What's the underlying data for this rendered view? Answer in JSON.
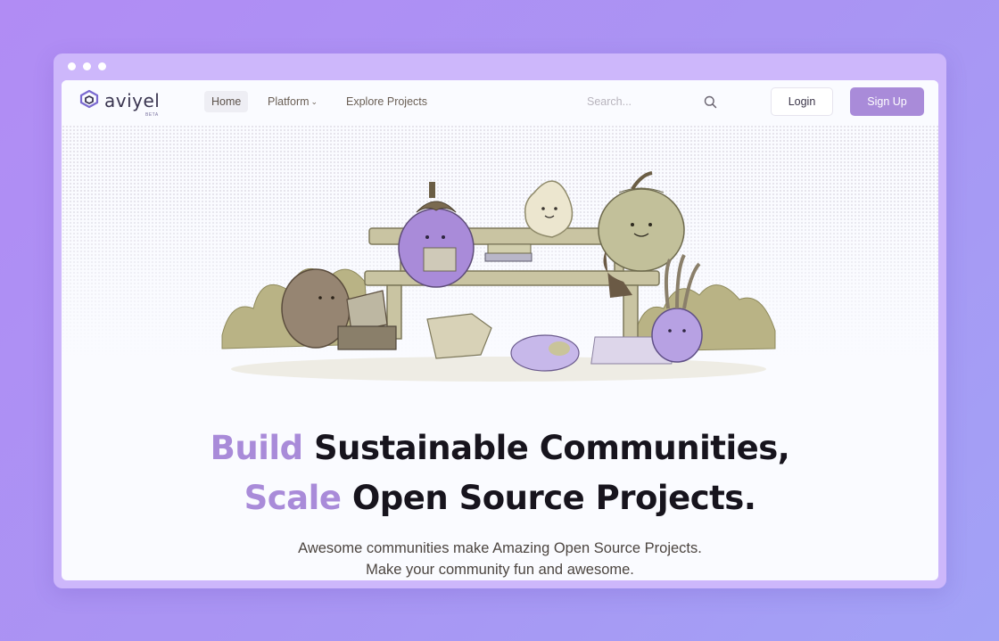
{
  "brand": {
    "name": "aviyel",
    "tag": "BETA"
  },
  "nav": {
    "items": [
      {
        "label": "Home",
        "active": true
      },
      {
        "label": "Platform",
        "has_dropdown": true
      },
      {
        "label": "Explore Projects"
      }
    ]
  },
  "search": {
    "placeholder": "Search..."
  },
  "auth": {
    "login_label": "Login",
    "signup_label": "Sign Up"
  },
  "hero": {
    "line1_accent": "Build",
    "line1_rest": "Sustainable Communities,",
    "line2_accent": "Scale",
    "line2_rest": "Open Source Projects.",
    "subtitle_line1": "Awesome communities make Amazing Open Source Projects.",
    "subtitle_line2": "Make your community fun and awesome."
  },
  "colors": {
    "background_gradient": [
      "#b18cf4",
      "#a2a2f6"
    ],
    "accent": "#a98bd9",
    "frame": "#cdb7fb",
    "text_dark": "#17141d"
  },
  "icons": {
    "search": "search-icon",
    "dropdown": "chevron-down-icon",
    "logo": "aviyel-logo-mark"
  }
}
